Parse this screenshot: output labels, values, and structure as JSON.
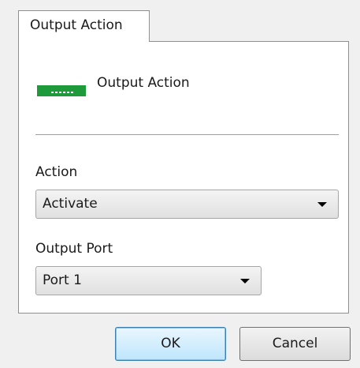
{
  "tabs": [
    {
      "label": "Output Action",
      "selected": true
    }
  ],
  "header": {
    "icon": "output-port-icon",
    "label": "Output Action"
  },
  "action": {
    "label": "Action",
    "selected": "Activate"
  },
  "output_port": {
    "label": "Output Port",
    "selected": "Port 1"
  },
  "buttons": {
    "ok_label": "OK",
    "cancel_label": "Cancel"
  },
  "colors": {
    "icon_green": "#1e9a3a",
    "ok_focus": "#3c7fb1"
  }
}
